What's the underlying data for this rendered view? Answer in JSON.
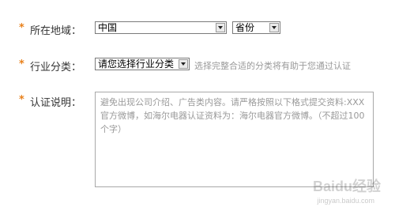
{
  "form": {
    "region": {
      "star": "*",
      "label": "所在地域：",
      "country_value": "中国",
      "province_value": "省份"
    },
    "industry": {
      "star": "*",
      "label": "行业分类：",
      "select_value": "请您选择行业分类",
      "hint": "选择完整合适的分类将有助于您通过认证"
    },
    "description": {
      "star": "*",
      "label": "认证说明：",
      "placeholder": "避免出现公司介绍、广告类内容。请严格按照以下格式提交资料:XXX官方微博，如海尔电器认证资料为：海尔电器官方微博。（不超过100个字）"
    }
  },
  "watermark": {
    "text": "Baidu经验",
    "url": "jingyan.baidu.com"
  },
  "colors": {
    "accent_star": "#e8801a",
    "hint_text": "#999999",
    "border": "#7a7a7a"
  }
}
